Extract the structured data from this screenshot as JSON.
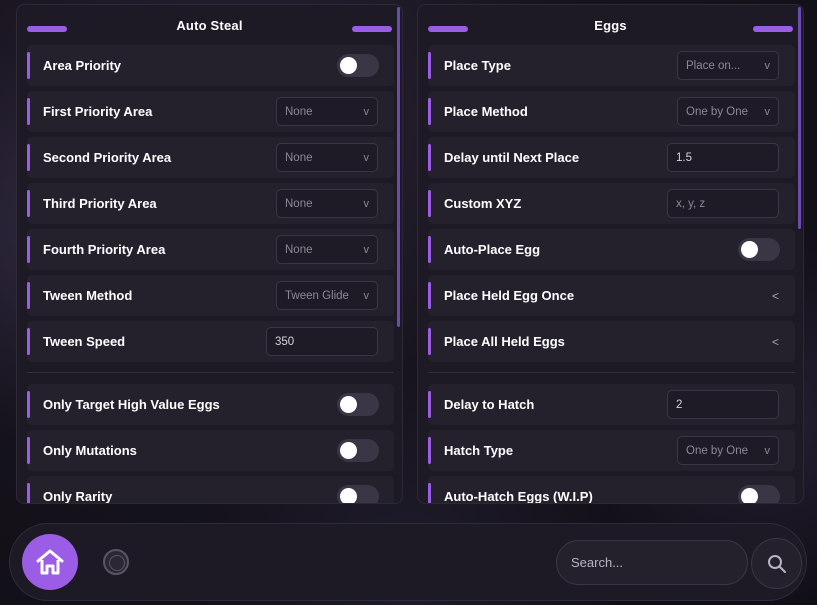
{
  "left_panel": {
    "title": "Auto Steal",
    "rows": [
      {
        "label": "Area Priority",
        "control": "toggle"
      },
      {
        "label": "First Priority Area",
        "control": "dropdown",
        "value": "None"
      },
      {
        "label": "Second Priority Area",
        "control": "dropdown",
        "value": "None"
      },
      {
        "label": "Third Priority Area",
        "control": "dropdown",
        "value": "None"
      },
      {
        "label": "Fourth Priority Area",
        "control": "dropdown",
        "value": "None"
      },
      {
        "label": "Tween Method",
        "control": "dropdown",
        "value": "Tween Glide"
      },
      {
        "label": "Tween Speed",
        "control": "textbox",
        "value": "350"
      },
      {
        "label": "Only Target High Value Eggs",
        "control": "toggle"
      },
      {
        "label": "Only Mutations",
        "control": "toggle"
      },
      {
        "label": "Only Rarity",
        "control": "toggle"
      }
    ]
  },
  "right_panel": {
    "title": "Eggs",
    "rows": [
      {
        "label": "Place Type",
        "control": "dropdown",
        "value": "Place on..."
      },
      {
        "label": "Place Method",
        "control": "dropdown",
        "value": "One by One"
      },
      {
        "label": "Delay until Next Place",
        "control": "textbox",
        "value": "1.5"
      },
      {
        "label": "Custom XYZ",
        "control": "textbox",
        "placeholder": "x, y, z"
      },
      {
        "label": "Auto-Place Egg",
        "control": "toggle"
      },
      {
        "label": "Place Held Egg Once",
        "control": "button",
        "arrow": "<"
      },
      {
        "label": "Place All Held Eggs",
        "control": "button",
        "arrow": "<"
      },
      {
        "label": "Delay to Hatch",
        "control": "textbox",
        "value": "2"
      },
      {
        "label": "Hatch Type",
        "control": "dropdown",
        "value": "One by One"
      },
      {
        "label": "Auto-Hatch Eggs (W.I.P)",
        "control": "toggle"
      }
    ]
  },
  "dropdown_arrow": "v",
  "bottom_bar": {
    "home_icon": "home-icon",
    "avatar_icon": "avatar-icon",
    "search_placeholder": "Search...",
    "search_icon": "search-icon"
  },
  "colors": {
    "accent": "#9b5de5",
    "panel": "#1d1a25",
    "row": "#24212d"
  }
}
